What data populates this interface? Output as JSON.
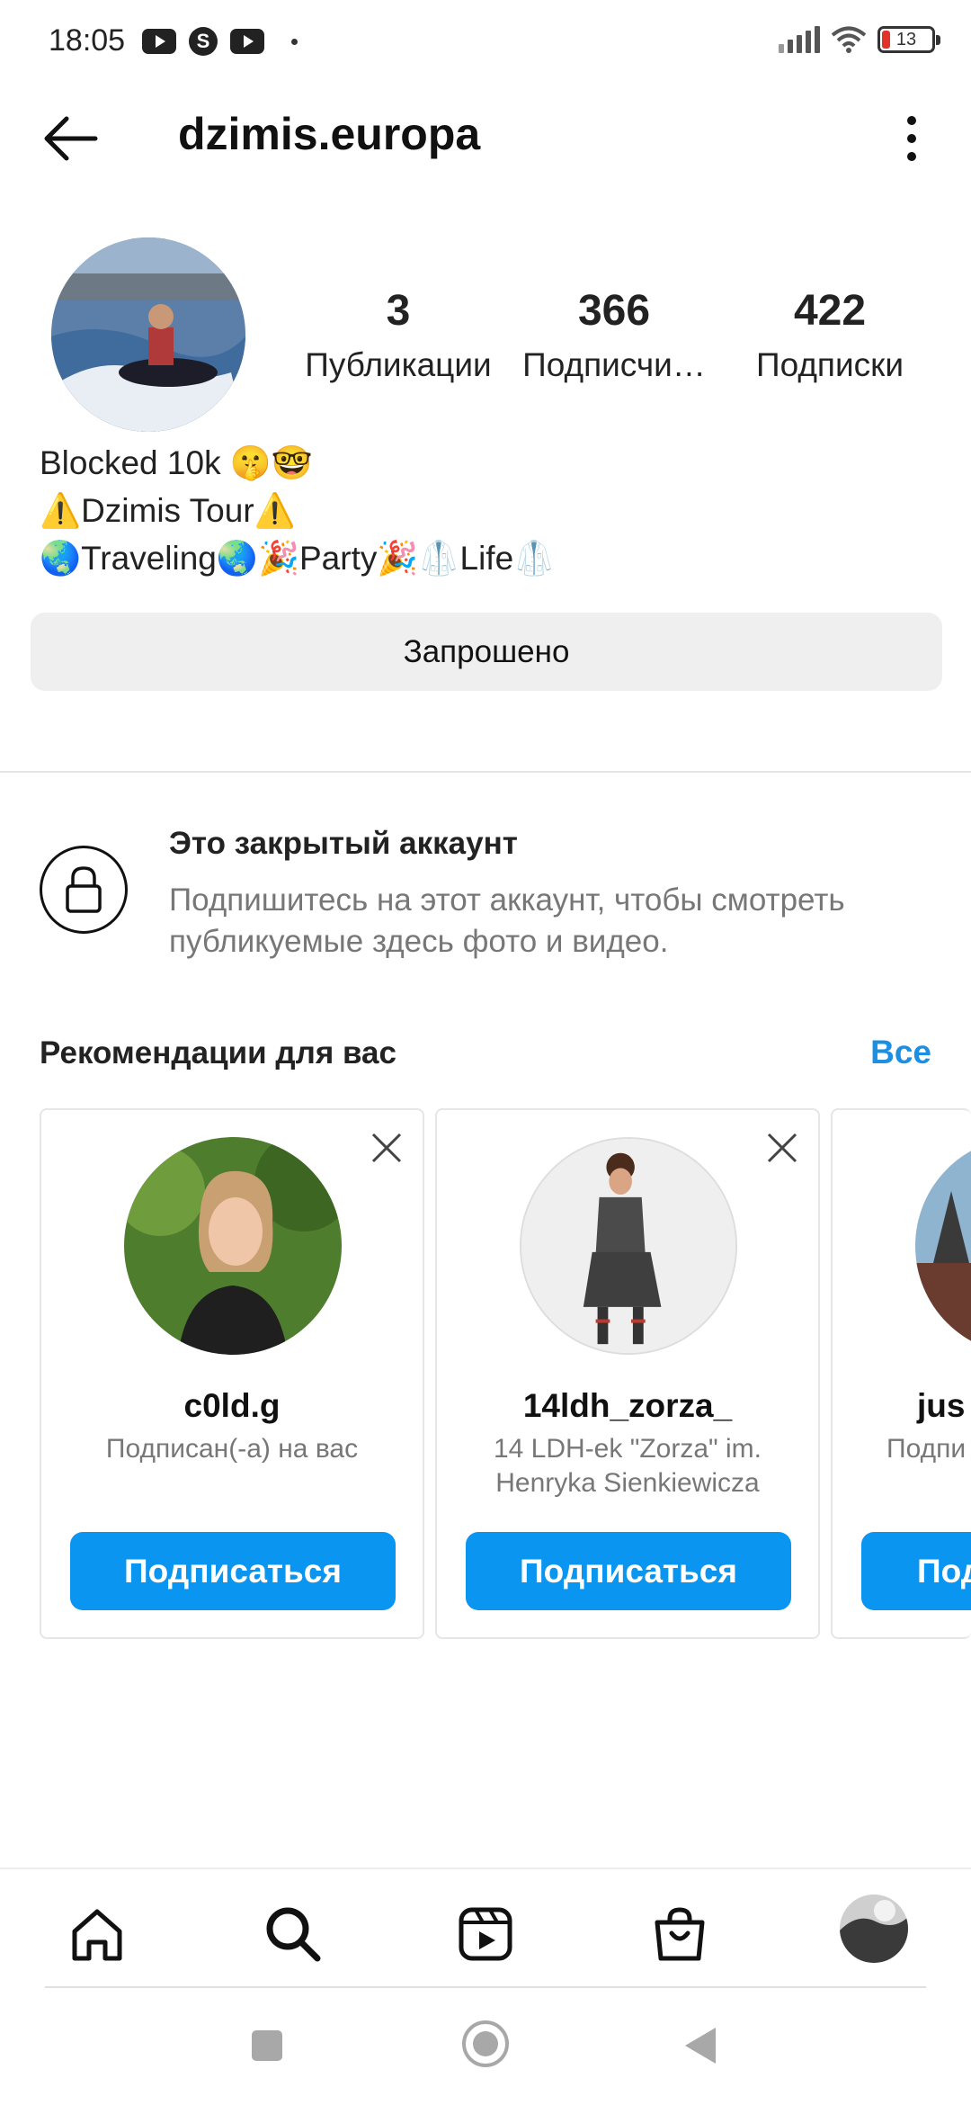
{
  "status_bar": {
    "time": "18:05",
    "battery": "13",
    "icons": [
      "youtube-icon",
      "s-app-icon",
      "youtube-icon",
      "notification-dot",
      "signal-icon",
      "wifi-icon",
      "battery-icon"
    ]
  },
  "header": {
    "username": "dzimis.europa",
    "back_icon": "arrow-left-icon",
    "menu_icon": "more-vertical-icon"
  },
  "profile": {
    "stats": [
      {
        "value": "3",
        "label": "Публикации"
      },
      {
        "value": "366",
        "label": "Подписчи…"
      },
      {
        "value": "422",
        "label": "Подписки"
      }
    ],
    "bio_lines": [
      "Blocked 10k 🤫🤓",
      "⚠️Dzimis Tour⚠️",
      "🌏Traveling🌏🎉Party🎉🥼Life🥼"
    ],
    "requested_label": "Запрошено"
  },
  "private_notice": {
    "title": "Это закрытый аккаунт",
    "description": "Подпишитесь на этот аккаунт, чтобы смотреть публикуемые здесь фото и видео.",
    "icon": "lock-icon"
  },
  "suggestions": {
    "title": "Рекомендации для вас",
    "see_all": "Все",
    "cards": [
      {
        "username": "c0ld.g",
        "subtitle": "Подписан(-а) на вас",
        "button": "Подписаться"
      },
      {
        "username": "14ldh_zorza_",
        "subtitle": "14 LDH-ek \"Zorza\" im. Henryka Sienkiewicza",
        "button": "Подписаться"
      },
      {
        "username": "jus",
        "subtitle": "Подпи",
        "button": "Под"
      }
    ]
  },
  "bottom_nav": {
    "items": [
      "home-icon",
      "search-icon",
      "reels-icon",
      "shop-icon",
      "profile-avatar"
    ]
  },
  "colors": {
    "accent": "#0a95f0",
    "link": "#1a8fe3",
    "secondary_text": "#777777",
    "button_bg": "#efefef"
  }
}
